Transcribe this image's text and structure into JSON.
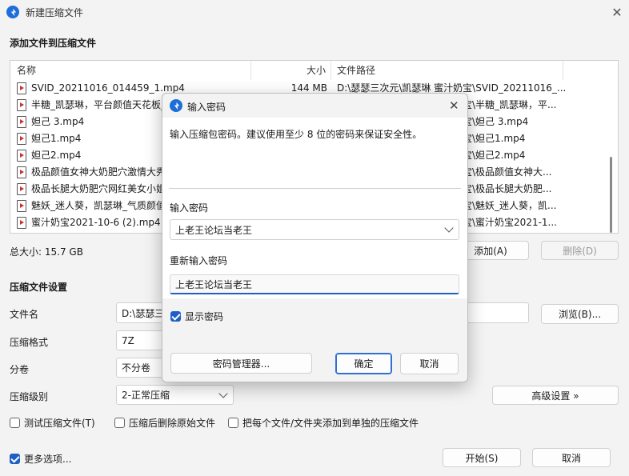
{
  "window": {
    "title": "新建压缩文件",
    "close_glyph": "✕"
  },
  "add_section": {
    "title": "添加文件到压缩文件"
  },
  "filelist": {
    "columns": {
      "name": "名称",
      "size": "大小",
      "path": "文件路径"
    },
    "rows": [
      {
        "name": "SVID_20211016_014459_1.mp4",
        "size": "144 MB",
        "path": "D:\\瑟瑟三次元\\凯瑟琳 蜜汁奶宝\\SVID_20211016_..."
      },
      {
        "name": "半糖_凯瑟琳，平台颜值天花板_",
        "size": "",
        "path": "宝\\半糖_凯瑟琳，平..."
      },
      {
        "name": "妲己 3.mp4",
        "size": "",
        "path": "宝\\妲己 3.mp4"
      },
      {
        "name": "妲己1.mp4",
        "size": "",
        "path": "宝\\妲己1.mp4"
      },
      {
        "name": "妲己2.mp4",
        "size": "",
        "path": "宝\\妲己2.mp4"
      },
      {
        "name": "极品颜值女神大奶肥穴激情大秀",
        "size": "",
        "path": "宝\\极品颜值女神大..."
      },
      {
        "name": "极品长腿大奶肥穴网红美女小姐",
        "size": "",
        "path": "宝\\极品长腿大奶肥..."
      },
      {
        "name": "魅妖_迷人葵，凯瑟琳_气质颜值",
        "size": "",
        "path": "宝\\魅妖_迷人葵，凯..."
      },
      {
        "name": "蜜汁奶宝2021-10-6 (2).mp4",
        "size": "",
        "path": "宝\\蜜汁奶宝2021-1..."
      }
    ]
  },
  "total_size": "总大小: 15.7 GB",
  "buttons": {
    "add": "添加(A)",
    "delete": "删除(D)",
    "browse": "浏览(B)...",
    "advanced": "高级设置 »",
    "start": "开始(S)",
    "cancel": "取消"
  },
  "settings": {
    "title": "压缩文件设置",
    "filename_label": "文件名",
    "filename_value": "D:\\瑟瑟三",
    "format_label": "压缩格式",
    "format_value": "7Z",
    "split_label": "分卷",
    "split_value": "不分卷",
    "level_label": "压缩级别",
    "level_value": "2-正常压缩"
  },
  "options": {
    "test": "测试压缩文件(T)",
    "delete_after": "压缩后删除原始文件",
    "each_separate": "把每个文件/文件夹添加到单独的压缩文件",
    "more": "更多选项..."
  },
  "dialog": {
    "title": "输入密码",
    "close_glyph": "✕",
    "description": "输入压缩包密码。建议使用至少 8 位的密码来保证安全性。",
    "password_label": "输入密码",
    "password_value": "上老王论坛当老王",
    "confirm_label": "重新输入密码",
    "confirm_value": "上老王论坛当老王",
    "show_password": "显示密码",
    "manager_button": "密码管理器...",
    "ok_button": "确定",
    "cancel_button": "取消"
  },
  "colors": {
    "accent": "#1d5fc6",
    "app_icon": "#1d6ed8"
  }
}
